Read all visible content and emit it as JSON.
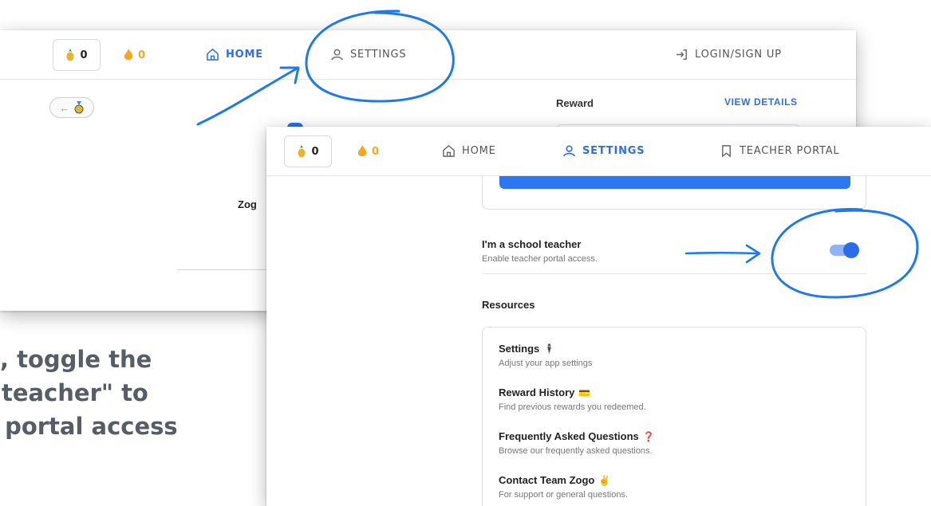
{
  "back_window": {
    "nav": {
      "pineapple_count": "0",
      "streak_count": "0",
      "home_label": "HOME",
      "settings_label": "SETTINGS",
      "login_label": "LOGIN/SIGN UP"
    },
    "reward_label": "Reward",
    "view_details_label": "VIEW DETAILS",
    "partial_text": "Zog"
  },
  "front_window": {
    "nav": {
      "pineapple_count": "0",
      "streak_count": "0",
      "home_label": "HOME",
      "settings_label": "SETTINGS",
      "teacher_portal_label": "TEACHER PORTAL"
    },
    "teacher_toggle": {
      "title": "I'm a school teacher",
      "subtitle": "Enable teacher portal access.",
      "enabled": true
    },
    "resources_heading": "Resources",
    "resources": [
      {
        "title": "Settings",
        "subtitle": "Adjust your app settings",
        "emoji": "🕴"
      },
      {
        "title": "Reward History",
        "subtitle": "Find previous rewards you redeemed.",
        "emoji": "💳"
      },
      {
        "title": "Frequently Asked Questions",
        "subtitle": "Browse our frequently asked questions.",
        "emoji": "❓"
      },
      {
        "title": "Contact Team Zogo",
        "subtitle": "For support or general questions.",
        "emoji": "✌"
      }
    ]
  },
  "caption": {
    "line1": "gs, toggle the",
    "line2": "ol teacher\" to",
    "line3": "er portal access"
  },
  "colors": {
    "accent": "#2f6ee8",
    "annotation": "#1f7ae8",
    "streak": "#f5a623"
  }
}
